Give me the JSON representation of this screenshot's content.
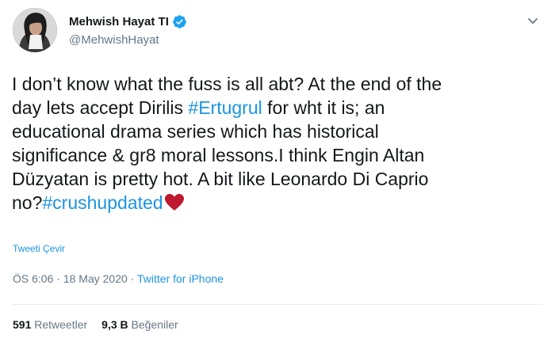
{
  "user": {
    "display_name": "Mehwish Hayat TI",
    "handle": "@MehwishHayat",
    "avatar_icon": "profile-photo",
    "verified_icon": "verified-badge-icon"
  },
  "tweet": {
    "lines": [
      [
        {
          "text": "I don’t know what the fuss is all abt? At the end of the",
          "tag": false
        }
      ],
      [
        {
          "text": "day lets accept Dirilis ",
          "tag": false
        },
        {
          "text": "#Ertugrul",
          "tag": true
        },
        {
          "text": " for wht it is; an",
          "tag": false
        }
      ],
      [
        {
          "text": "educational drama series which has historical",
          "tag": false
        }
      ],
      [
        {
          "text": "significance & gr8 moral lessons.I think Engin Altan",
          "tag": false
        }
      ],
      [
        {
          "text": "Düzyatan is pretty hot. A bit like Leonardo Di Caprio",
          "tag": false
        }
      ],
      [
        {
          "text": "no?",
          "tag": false
        },
        {
          "text": "#crushupdated",
          "tag": true
        }
      ]
    ],
    "emoji": "red-heart-icon"
  },
  "translate_label": "Tweeti Çevir",
  "meta": {
    "time": "ÖS 6:06",
    "sep1": " · ",
    "date": "18 May 2020",
    "sep2": " · ",
    "source": "Twitter for iPhone"
  },
  "stats": {
    "retweets_count": "591",
    "retweets_label": "Retweetler",
    "likes_count": "9,3 B",
    "likes_label": "Beğeniler"
  },
  "colors": {
    "link": "#1b95e0",
    "secondary": "#657786",
    "primary": "#14171a",
    "heart": "#be1931",
    "verified": "#1da1f2"
  }
}
